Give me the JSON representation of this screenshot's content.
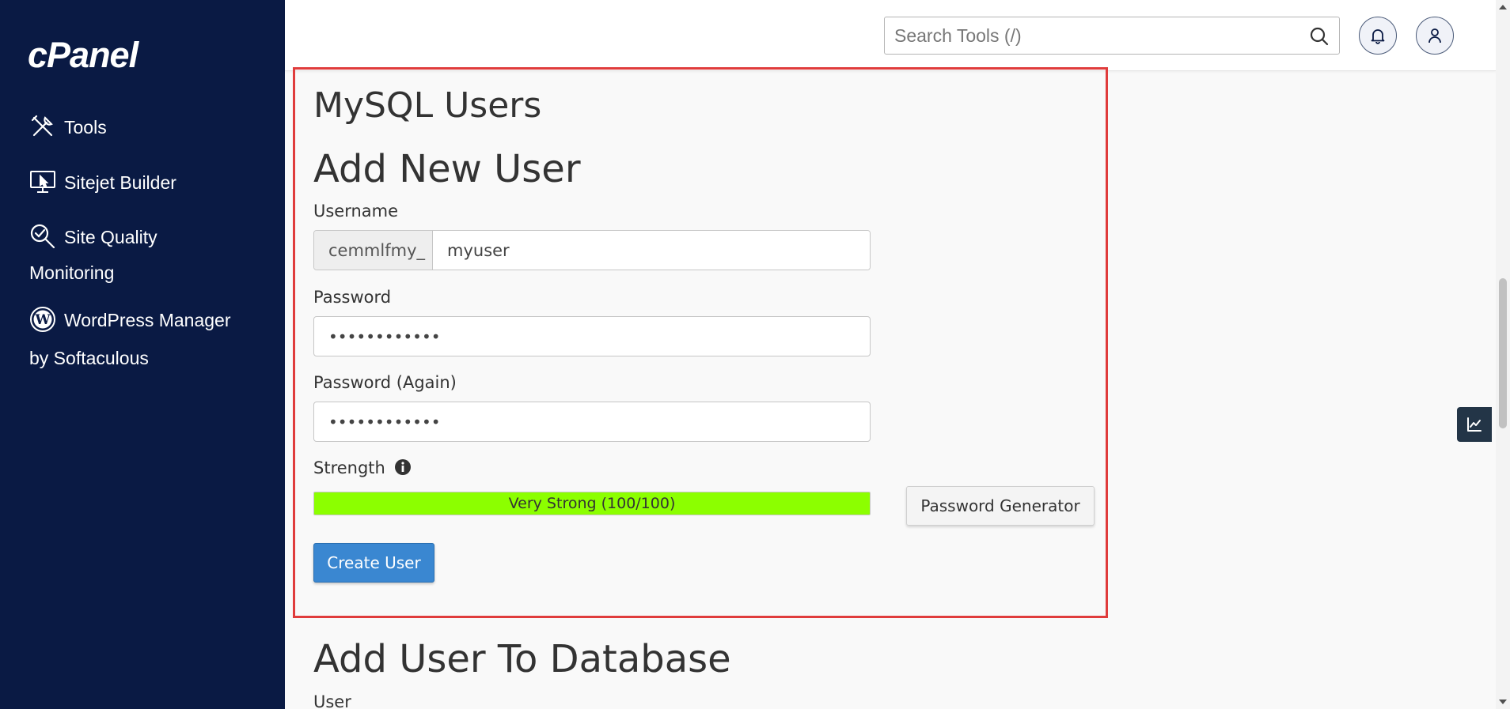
{
  "sidebar": {
    "logo": "cPanel",
    "items": [
      {
        "label": "Tools",
        "icon": "tools-icon"
      },
      {
        "label": "Sitejet Builder",
        "icon": "monitor-icon"
      },
      {
        "label_line1": "Site Quality",
        "label_line2": "Monitoring",
        "icon": "magnifier-check-icon"
      },
      {
        "label_line1": "WordPress Manager",
        "label_line2": "by Softaculous",
        "icon": "wordpress-icon"
      }
    ]
  },
  "header": {
    "search_placeholder": "Search Tools (/)",
    "icons": [
      "search-icon",
      "bell-icon",
      "user-icon"
    ]
  },
  "main": {
    "page_title": "MySQL Users",
    "add_user": {
      "title": "Add New User",
      "username_label": "Username",
      "username_prefix": "cemmlfmy_",
      "username_value": "myuser",
      "password_label": "Password",
      "password_value": "••••••••••••",
      "password_again_label": "Password (Again)",
      "password_again_value": "••••••••••••",
      "strength_label": "Strength",
      "strength_text": "Very Strong (100/100)",
      "strength_percent": 100,
      "password_generator_label": "Password Generator",
      "create_user_label": "Create User"
    },
    "add_user_to_db": {
      "title": "Add User To Database",
      "user_label": "User"
    }
  },
  "colors": {
    "sidebar_bg": "#0a1a44",
    "highlight_border": "#e03c3c",
    "strength_bar": "#8cff00",
    "primary_button": "#3a87d1"
  }
}
